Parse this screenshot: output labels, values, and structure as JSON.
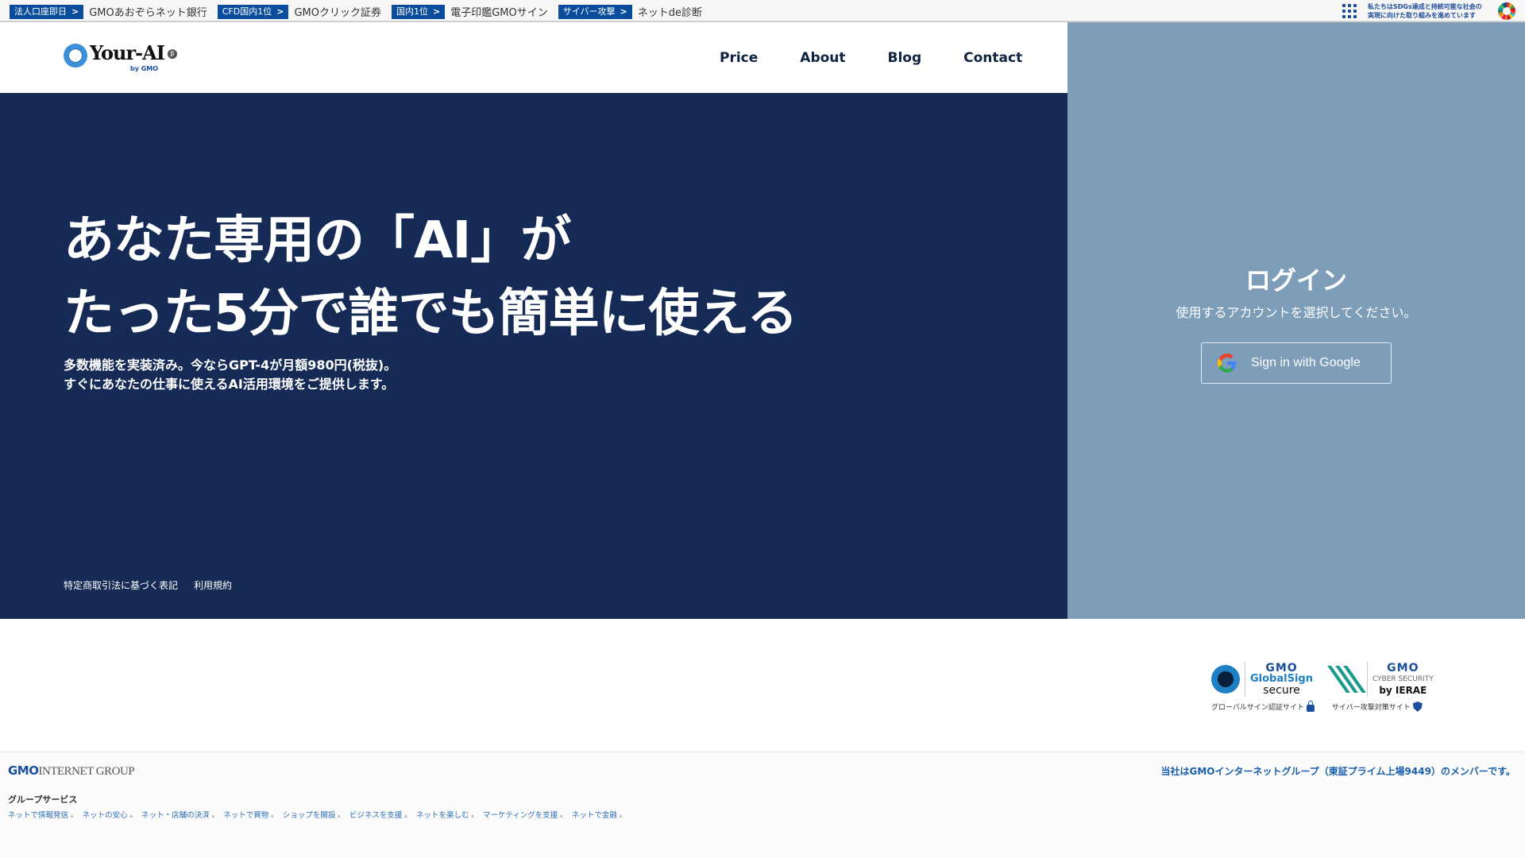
{
  "topbar": {
    "ticker": [
      {
        "tag": "法人口座即日",
        "arrow": ">",
        "text": "GMOあおぞらネット銀行"
      },
      {
        "tag": "CFD国内1位",
        "arrow": ">",
        "text": "GMOクリック証券"
      },
      {
        "tag": "国内1位",
        "arrow": ">",
        "text": "電子印鑑GMOサイン"
      },
      {
        "tag": "サイバー攻撃",
        "arrow": ">",
        "text": "ネットde診断"
      }
    ],
    "sdgs": {
      "line1": "私たちはSDGs達成と持続可能な社会の",
      "line2": "実現に向けた取り組みを進めています",
      "icon": "sdgs-wheel-icon",
      "menu_icon": "grid-menu-icon"
    }
  },
  "header": {
    "logo": {
      "name": "Your-AI",
      "beta": "β",
      "by": "by GMO"
    },
    "nav": [
      "Price",
      "About",
      "Blog",
      "Contact"
    ]
  },
  "hero": {
    "headline_line1": "あなた専用の「AI」が",
    "headline_line2": "たった5分で誰でも簡単に使える",
    "sub_line1": "多数機能を実装済み。今ならGPT-4が月額980円(税抜)。",
    "sub_line2": "すぐにあなたの仕事に使えるAI活用環境をご提供します。",
    "links": [
      "特定商取引法に基づく表記",
      "利用規約"
    ]
  },
  "login": {
    "title": "ログイン",
    "description": "使用するアカウントを選択してください。",
    "google_button": "Sign in with Google",
    "colors": {
      "panel": "#7d9db8",
      "hero": "#152a55"
    }
  },
  "badges": [
    {
      "brand": "GMO",
      "name": "GlobalSign",
      "sub": "secure",
      "caption": "グローバルサイン認証サイト",
      "icon": "lock-icon"
    },
    {
      "brand": "GMO",
      "name": "CYBER SECURITY",
      "sub": "by IERAE",
      "caption": "サイバー攻撃対策サイト",
      "icon": "shield-check-icon"
    }
  ],
  "footer": {
    "group_logo_bold": "GMO",
    "group_logo_rest": "INTERNET GROUP",
    "member_text": "当社はGMOインターネットグループ（東証プライム上場9449）のメンバーです。",
    "group_services_title": "グループサービス",
    "group_services": [
      "ネットで情報発信",
      "ネットの安心",
      "ネット・店舗の決済",
      "ネットで買物",
      "ショップを開設",
      "ビジネスを支援",
      "ネットを楽しむ",
      "マーケティングを支援",
      "ネットで金融"
    ]
  }
}
